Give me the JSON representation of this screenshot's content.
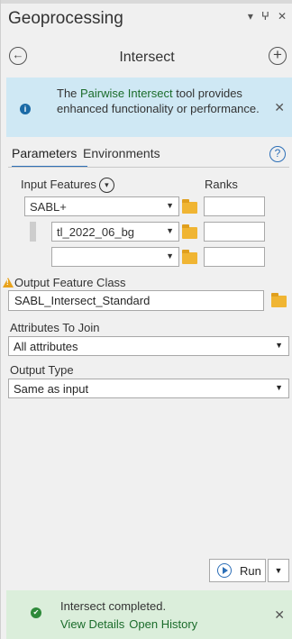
{
  "window": {
    "title": "Geoprocessing",
    "pin_glyph": "▾ ⫨ ✕"
  },
  "header": {
    "tool_name": "Intersect",
    "back_icon": "arrow-left-circle",
    "add_icon": "plus-circle"
  },
  "info_banner": {
    "text_before": "The ",
    "link": "Pairwise Intersect",
    "text_after": " tool provides enhanced functionality or performance.",
    "close": "✕"
  },
  "tabs": [
    {
      "label": "Parameters"
    },
    {
      "label": "Environments"
    }
  ],
  "help": "?",
  "input_features": {
    "label": "Input Features",
    "ranks_label": "Ranks",
    "rows": [
      {
        "value": "SABL+"
      },
      {
        "value": "tl_2022_06_bg"
      },
      {
        "value": ""
      }
    ]
  },
  "output_feature_class": {
    "label": "Output Feature Class",
    "value": "SABL_Intersect_Standard"
  },
  "attributes_to_join": {
    "label": "Attributes To Join",
    "value": "All attributes"
  },
  "output_type": {
    "label": "Output Type",
    "value": "Same as input"
  },
  "run_button": {
    "label": "Run"
  },
  "success_banner": {
    "title": "Intersect completed.",
    "links": [
      "View Details",
      "Open History"
    ],
    "close": "✕"
  },
  "colors": {
    "accent": "#2d6fb7",
    "link_green": "#1b6c2b",
    "info_bg": "#cfe8f4",
    "success_bg": "#dbeedb",
    "folder": "#f0b533",
    "warning": "#e8a21b"
  }
}
